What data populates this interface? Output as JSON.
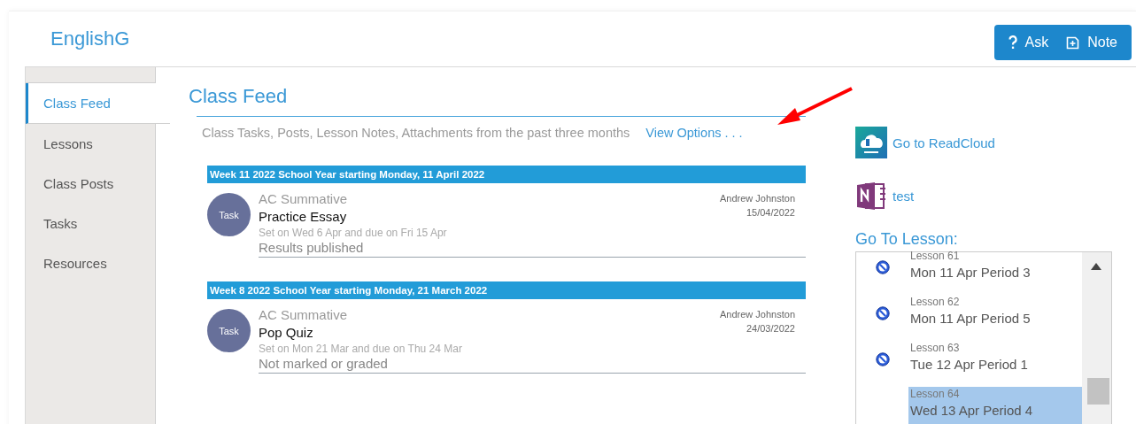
{
  "header": {
    "title": "EnglishG",
    "buttons": [
      {
        "kind": "ask",
        "label": "Ask"
      },
      {
        "kind": "note",
        "label": "Note"
      }
    ]
  },
  "sidebar": {
    "items": [
      {
        "label": "Class Feed",
        "selected": true
      },
      {
        "label": "Lessons",
        "selected": false
      },
      {
        "label": "Class Posts",
        "selected": false
      },
      {
        "label": "Tasks",
        "selected": false
      },
      {
        "label": "Resources",
        "selected": false
      }
    ]
  },
  "feed": {
    "title": "Class Feed",
    "subtitle": "Class Tasks, Posts, Lesson Notes, Attachments from the past three months",
    "options_link": "View Options . . .",
    "weeks": [
      {
        "heading": "Week 11 2022 School Year starting Monday, 11 April 2022",
        "items": [
          {
            "badge": "Task",
            "category": "AC Summative",
            "title": "Practice Essay",
            "dates": "Set on Wed 6 Apr and due on Fri 15 Apr",
            "status": "Results published",
            "author": "Andrew Johnston",
            "date": "15/04/2022"
          }
        ]
      },
      {
        "heading": "Week 8 2022 School Year starting Monday, 21 March 2022",
        "items": [
          {
            "badge": "Task",
            "category": "AC Summative",
            "title": "Pop Quiz",
            "dates": "Set on Mon 21 Mar and due on Thu 24 Mar",
            "status": "Not marked or graded",
            "author": "Andrew Johnston",
            "date": "24/03/2022"
          }
        ]
      }
    ]
  },
  "links": [
    {
      "kind": "readcloud",
      "label": "Go to ReadCloud"
    },
    {
      "kind": "onenote",
      "label": "test"
    }
  ],
  "lessons": {
    "title": "Go To Lesson:",
    "items": [
      {
        "number": "Lesson 61",
        "when": "Mon 11 Apr Period 3",
        "has_icon": true,
        "selected": false
      },
      {
        "number": "Lesson 62",
        "when": "Mon 11 Apr Period 5",
        "has_icon": true,
        "selected": false
      },
      {
        "number": "Lesson 63",
        "when": "Tue 12 Apr Period 1",
        "has_icon": true,
        "selected": false
      },
      {
        "number": "Lesson 64",
        "when": "Wed 13 Apr Period 4",
        "has_icon": false,
        "selected": true
      }
    ]
  }
}
